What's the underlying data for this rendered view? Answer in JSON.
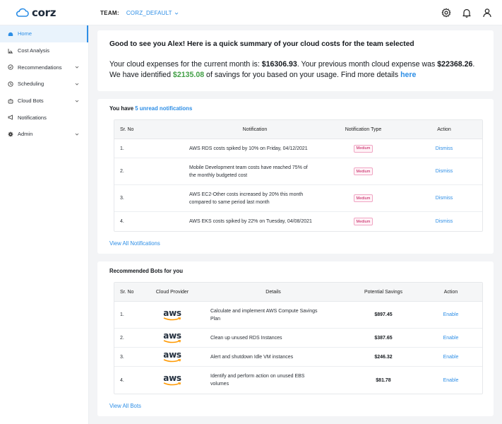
{
  "app": {
    "brand": "corz"
  },
  "header": {
    "team_label": "TEAM:",
    "team_value": "CORZ_DEFAULT"
  },
  "sidebar": {
    "items": [
      {
        "label": "Home",
        "icon": "home-icon",
        "active": true
      },
      {
        "label": "Cost Analysis",
        "icon": "chart-icon"
      },
      {
        "label": "Recommendations",
        "icon": "recommendations-icon",
        "expandable": true
      },
      {
        "label": "Scheduling",
        "icon": "clock-icon",
        "expandable": true
      },
      {
        "label": "Cloud Bots",
        "icon": "bot-icon",
        "expandable": true
      },
      {
        "label": "Notifications",
        "icon": "megaphone-icon"
      },
      {
        "label": "Admin",
        "icon": "gear-icon",
        "expandable": true
      }
    ]
  },
  "summary": {
    "greeting": "Good to see you Alex! Here is a quick summary of your cloud costs for the team selected",
    "line1_pre": "Your cloud expenses for the current month is: ",
    "current": "$16306.93",
    "line1_mid": ". Your previous month cloud expense was ",
    "previous": "$22368.26",
    "line1_end": ".",
    "line2_pre": "We have identified ",
    "savings": "$2135.08",
    "line2_mid": " of savings for you based on your usage. Find more details ",
    "link": "here"
  },
  "notifications": {
    "title_pre": "You have ",
    "title_link": "5 unread notifications",
    "headers": [
      "Sr. No",
      "Notification",
      "Notification Type",
      "Action"
    ],
    "rows": [
      {
        "no": "1.",
        "l1": "AWS RDS costs spiked by 10% on Friday, 04/12/2021",
        "l2": "",
        "type": "Medium",
        "action": "Dismiss"
      },
      {
        "no": "2.",
        "l1": "Mobile Development team costs have reached 75% of",
        "l2": "the monthly budgeted cost",
        "type": "Medium",
        "action": "Dismiss"
      },
      {
        "no": "3.",
        "l1": "AWS EC2-Other costs increased by 20% this month",
        "l2": "compared to same period last month",
        "type": "Medium",
        "action": "Dismiss"
      },
      {
        "no": "4.",
        "l1": "AWS EKS costs spiked by 22% on Tuesday, 04/08/2021",
        "l2": "",
        "type": "Medium",
        "action": "Dismiss"
      }
    ],
    "view_all": "View All  Notifications"
  },
  "bots": {
    "title": "Recommended Bots for you",
    "headers": [
      "Sr. No",
      "Cloud Provider",
      "Details",
      "Potential Savings",
      "Action"
    ],
    "rows": [
      {
        "no": "1.",
        "provider": "aws",
        "l1": "Calculate and implement AWS Compute Savings",
        "l2": "Plan",
        "savings": "$897.45",
        "action": "Enable"
      },
      {
        "no": "2.",
        "provider": "aws",
        "l1": "Clean up unused RDS Instances",
        "l2": "",
        "savings": "$387.65",
        "action": "Enable"
      },
      {
        "no": "3.",
        "provider": "aws",
        "l1": "Alert and shutdown Idle VM instances",
        "l2": "",
        "savings": "$246.32",
        "action": "Enable"
      },
      {
        "no": "4.",
        "provider": "aws",
        "l1": "Identify and perform action on unused EBS",
        "l2": "volumes",
        "savings": "$81.78",
        "action": "Enable"
      }
    ],
    "view_all": "View All Bots"
  },
  "colors": {
    "accent": "#2d8ee6",
    "savings_green": "#43a047",
    "badge": "#c2185b"
  }
}
